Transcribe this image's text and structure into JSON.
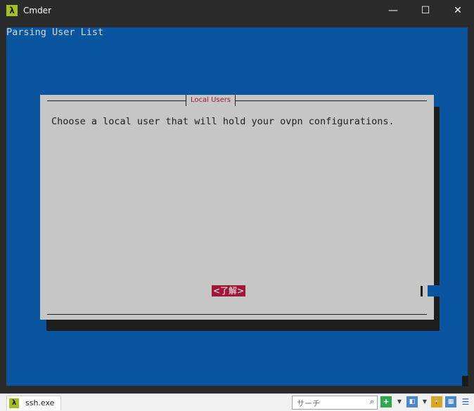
{
  "window": {
    "title": "Cmder",
    "app_icon_glyph": "λ",
    "minimize_glyph": "—",
    "maximize_glyph": "☐",
    "close_glyph": "✕"
  },
  "terminal": {
    "header_text": "Parsing User List",
    "background_color": "#0a55a0"
  },
  "dialog": {
    "title": "Local Users",
    "message": "Choose a local user that will hold your ovpn configurations.",
    "ok_button_label": "<了解>",
    "accent_color": "#a01838"
  },
  "statusbar": {
    "tab_label": "ssh.exe",
    "tab_icon_glyph": "λ",
    "search_placeholder": "サーチ",
    "search_icon_glyph": "⌕",
    "icons": {
      "plus": "+",
      "dropdown": "▼",
      "split": "◧",
      "lock": "🔒",
      "grid": "▦",
      "menu": "☰"
    }
  }
}
